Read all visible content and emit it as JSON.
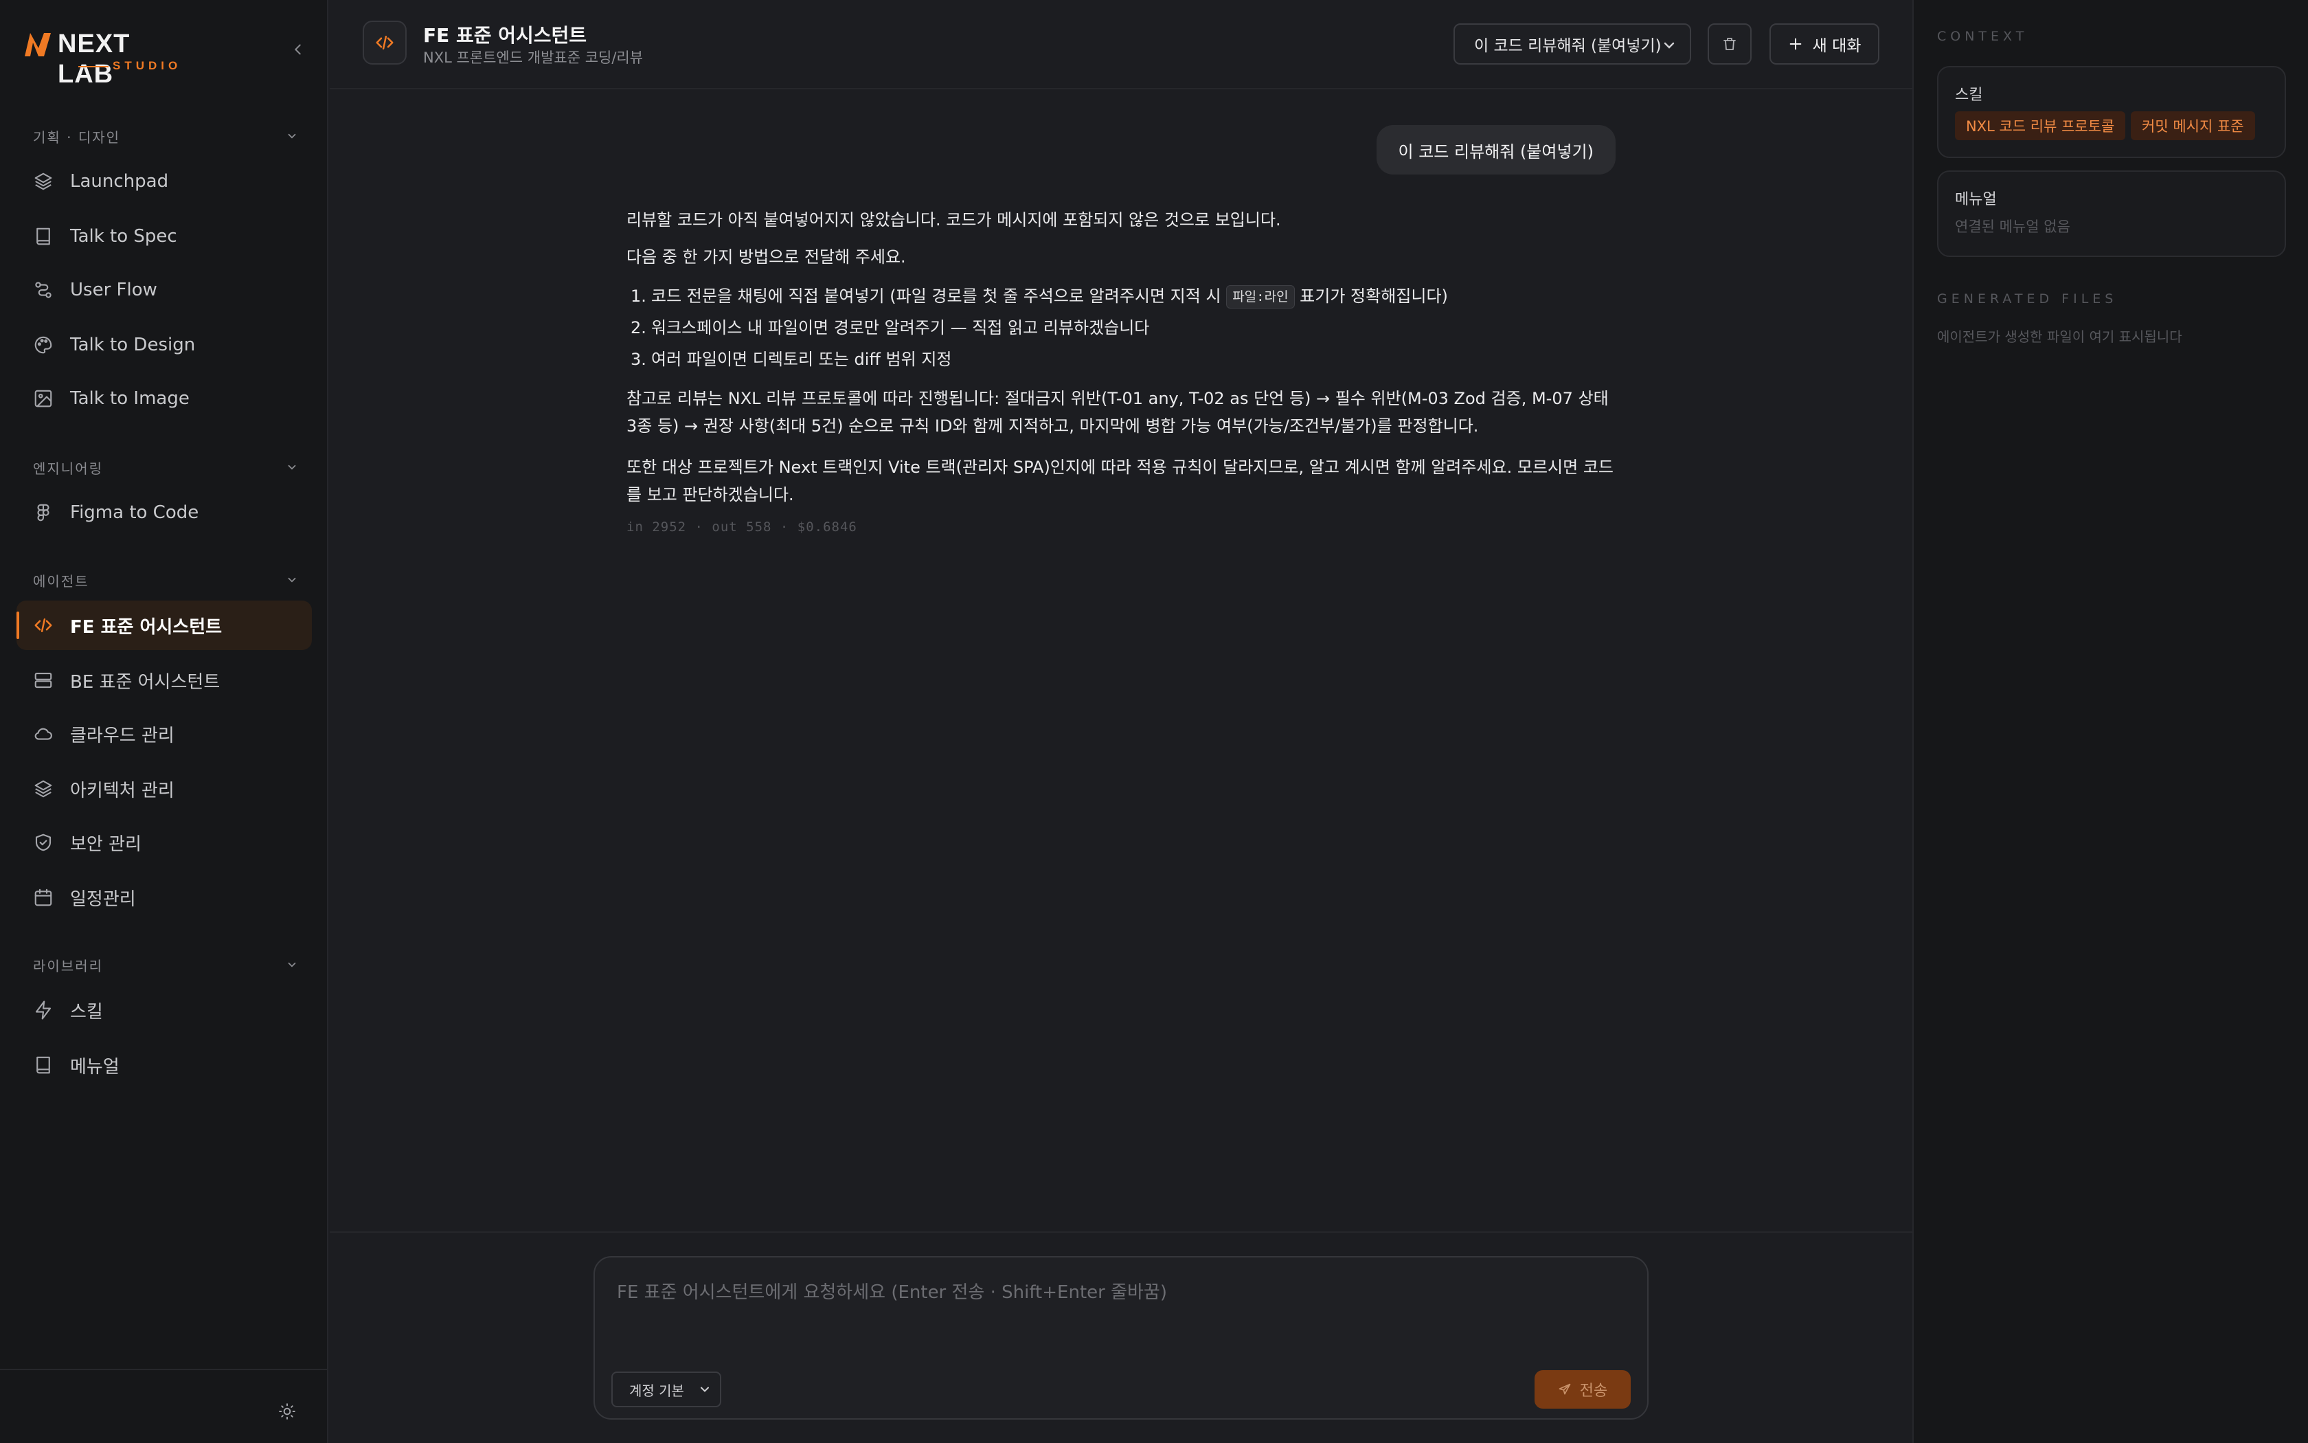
{
  "brand": {
    "name_part1": "NE",
    "name_x": "X",
    "name_part2": "T LAB",
    "sub": "STUDIO",
    "accent": "#f07a24"
  },
  "sidebar": {
    "sections": [
      {
        "title": "기획 · 디자인",
        "items": [
          {
            "label": "Launchpad",
            "icon": "layers-icon"
          },
          {
            "label": "Talk to Spec",
            "icon": "book-icon"
          },
          {
            "label": "User Flow",
            "icon": "flow-icon"
          },
          {
            "label": "Talk to Design",
            "icon": "palette-icon"
          },
          {
            "label": "Talk to Image",
            "icon": "image-icon"
          }
        ]
      },
      {
        "title": "엔지니어링",
        "items": [
          {
            "label": "Figma to Code",
            "icon": "figma-icon"
          }
        ]
      },
      {
        "title": "에이전트",
        "items": [
          {
            "label": "FE 표준 어시스턴트",
            "icon": "code-icon",
            "active": true
          },
          {
            "label": "BE 표준 어시스턴트",
            "icon": "server-icon"
          },
          {
            "label": "클라우드 관리",
            "icon": "cloud-icon"
          },
          {
            "label": "아키텍처 관리",
            "icon": "layers-icon"
          },
          {
            "label": "보안 관리",
            "icon": "shield-icon"
          },
          {
            "label": "일정관리",
            "icon": "calendar-icon"
          }
        ]
      },
      {
        "title": "라이브러리",
        "items": [
          {
            "label": "스킬",
            "icon": "bolt-icon"
          },
          {
            "label": "메뉴얼",
            "icon": "book-icon"
          }
        ]
      }
    ]
  },
  "header": {
    "title": "FE 표준 어시스턴트",
    "subtitle": "NXL 프론트엔드 개발표준 코딩/리뷰",
    "preset_value": "이 코드 리뷰해줘 (붙여넣기)",
    "new_chat_label": "새 대화"
  },
  "chat": {
    "user_message": "이 코드 리뷰해줘 (붙여넣기)",
    "assistant": {
      "p1": "리뷰할 코드가 아직 붙여넣어지지 않았습니다. 코드가 메시지에 포함되지 않은 것으로 보입니다.",
      "p2": "다음 중 한 가지 방법으로 전달해 주세요.",
      "list": [
        {
          "num": "1.",
          "before": "코드 전문을 채팅에 직접 붙여넣기 (파일 경로를 첫 줄 주석으로 알려주시면 지적 시 ",
          "code": "파일:라인",
          "after": " 표기가 정확해집니다)"
        },
        {
          "num": "2.",
          "before": "워크스페이스 내 파일이면 경로만 알려주기 — 직접 읽고 리뷰하겠습니다",
          "code": "",
          "after": ""
        },
        {
          "num": "3.",
          "before": "여러 파일이면 디렉토리 또는 diff 범위 지정",
          "code": "",
          "after": ""
        }
      ],
      "p3": "참고로 리뷰는 NXL 리뷰 프로토콜에 따라 진행됩니다: 절대금지 위반(T-01 any, T-02 as 단언 등) → 필수 위반(M-03 Zod 검증, M-07 상태 3종 등) → 권장 사항(최대 5건) 순으로 규칙 ID와 함께 지적하고, 마지막에 병합 가능 여부(가능/조건부/불가)를 판정합니다.",
      "p4": "또한 대상 프로젝트가 Next 트랙인지 Vite 트랙(관리자 SPA)인지에 따라 적용 규칙이 달라지므로, 알고 계시면 함께 알려주세요. 모르시면 코드를 보고 판단하겠습니다.",
      "usage": "in 2952 · out 558 · $0.6846"
    }
  },
  "composer": {
    "placeholder": "FE 표준 어시스턴트에게 요청하세요 (Enter 전송 · Shift+Enter 줄바꿈)",
    "model_value": "계정 기본",
    "send_label": "전송"
  },
  "context_panel": {
    "context_heading": "CONTEXT",
    "skills_title": "스킬",
    "skills": [
      "NXL 코드 리뷰 프로토콜",
      "커밋 메시지 표준"
    ],
    "manual_title": "메뉴얼",
    "manual_empty": "연결된 메뉴얼 없음",
    "files_heading": "GENERATED FILES",
    "files_empty": "에이전트가 생성한 파일이 여기 표시됩니다"
  }
}
